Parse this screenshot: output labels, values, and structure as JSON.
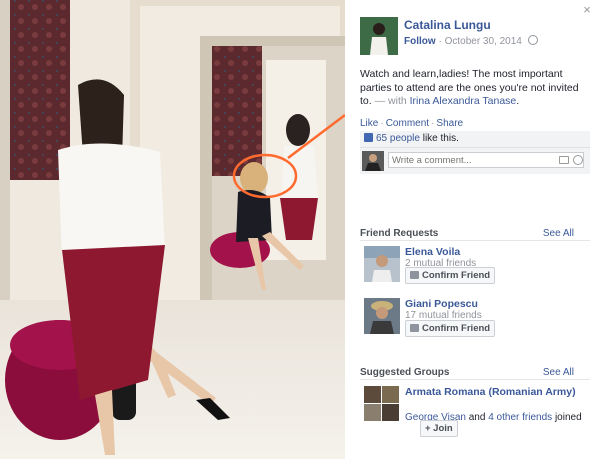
{
  "post": {
    "author": "Catalina Lungu",
    "follow_label": "Follow",
    "separator": "·",
    "date": "October 30, 2014",
    "text": "Watch and learn,ladies! The most important parties to attend are the ones you're not invited to.",
    "with_label": "— with",
    "tagged": "Irina Alexandra Tanase",
    "period": ".",
    "action_like": "Like",
    "action_comment": "Comment",
    "action_share": "Share",
    "action_sep": "·",
    "likes_count": "65 people",
    "likes_suffix": "like this.",
    "comment_placeholder": "Write a comment..."
  },
  "close_glyph": "×",
  "friend_requests": {
    "title": "Friend Requests",
    "see_all": "See All",
    "items": [
      {
        "name": "Elena Voila",
        "mutual": "2 mutual friends",
        "button": "Confirm Friend"
      },
      {
        "name": "Giani Popescu",
        "mutual": "17 mutual friends",
        "button": "Confirm Friend"
      }
    ]
  },
  "suggested_groups": {
    "title": "Suggested Groups",
    "see_all": "See All",
    "items": [
      {
        "name": "Armata Romana (Romanian Army)",
        "member": "George Visan",
        "and": "and",
        "others": "4 other friends",
        "joined": "joined",
        "join_label": "+ Join"
      }
    ]
  },
  "colors": {
    "link": "#3b5998",
    "annotation": "#ff6a2e"
  },
  "icons": [
    "close-icon",
    "globe-icon",
    "thumbs-up-icon",
    "camera-icon",
    "smiley-icon",
    "add-friend-icon"
  ]
}
